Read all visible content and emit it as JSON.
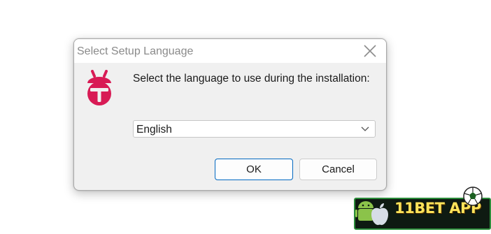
{
  "dialog": {
    "title": "Select Setup Language",
    "close_icon": "close-icon",
    "app_icon": "installer-app-icon",
    "prompt": "Select the language to use during the installation:",
    "language_select": {
      "selected": "English"
    },
    "ok_label": "OK",
    "cancel_label": "Cancel"
  },
  "watermark": {
    "text": "11BET APP"
  },
  "colors": {
    "accent": "#0067c0",
    "app_icon": "#d81b55"
  }
}
